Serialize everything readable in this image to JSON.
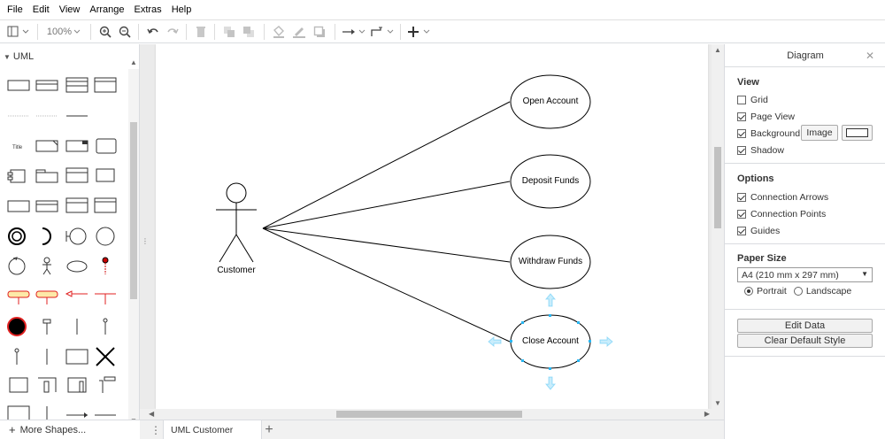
{
  "menu": [
    "File",
    "Edit",
    "View",
    "Arrange",
    "Extras",
    "Help"
  ],
  "toolbar": {
    "zoom": "100%"
  },
  "sidebar": {
    "library": "UML",
    "more_shapes": "More Shapes..."
  },
  "diagram": {
    "actor_label": "Customer",
    "use_cases": [
      "Open Account",
      "Deposit Funds",
      "Withdraw Funds",
      "Close Account"
    ]
  },
  "tabs": {
    "page_name": "UML Customer"
  },
  "panel": {
    "title": "Diagram",
    "view": {
      "title": "View",
      "grid": "Grid",
      "page_view": "Page View",
      "background": "Background",
      "image_button": "Image",
      "shadow": "Shadow"
    },
    "options": {
      "title": "Options",
      "connection_arrows": "Connection Arrows",
      "connection_points": "Connection Points",
      "guides": "Guides"
    },
    "paper": {
      "title": "Paper Size",
      "size": "A4 (210 mm x 297 mm)",
      "portrait": "Portrait",
      "landscape": "Landscape"
    },
    "edit_data": "Edit Data",
    "clear_style": "Clear Default Style"
  },
  "colors": {
    "selection": "#29b6f2",
    "accent_red": "#ff0000",
    "border": "#dadce0"
  }
}
